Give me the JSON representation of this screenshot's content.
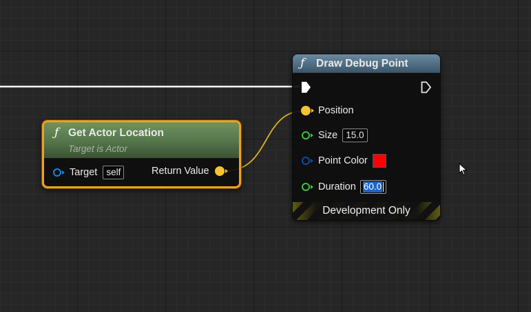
{
  "colors": {
    "graph_background": "#262626",
    "exec_wire": "#ffffff",
    "vector_wire": "#e2b225",
    "selection_outline": "#f0a020",
    "function_header_green": "#5b7a4e",
    "function_header_blue": "#4d6a80",
    "point_color_swatch": "#ff0000",
    "vector_pin": "#f6c22e",
    "object_pin": "#1786e6",
    "float_pin": "#3cc43c",
    "color_pin": "#134aa0"
  },
  "nodes": {
    "get_actor_location": {
      "title": "Get Actor Location",
      "subtitle": "Target is Actor",
      "icon": "function-icon",
      "selected": true,
      "inputs": [
        {
          "label": "Target",
          "value": "self",
          "pin_icon": "object-pin-icon"
        }
      ],
      "outputs": [
        {
          "label": "Return Value",
          "pin_icon": "vector-pin-icon"
        }
      ]
    },
    "draw_debug_point": {
      "title": "Draw Debug Point",
      "icon": "function-icon",
      "exec_in_icon": "exec-in-pin-icon",
      "exec_out_icon": "exec-out-pin-icon",
      "inputs": [
        {
          "label": "Position",
          "pin_icon": "vector-pin-icon"
        },
        {
          "label": "Size",
          "value": "15.0",
          "pin_icon": "float-pin-icon"
        },
        {
          "label": "Point Color",
          "value": "#ff0000",
          "pin_icon": "color-pin-icon"
        },
        {
          "label": "Duration",
          "value": "60.0",
          "pin_icon": "float-pin-icon",
          "editing": true
        }
      ],
      "footer": "Development Only"
    }
  },
  "cursor_icon": "mouse-pointer-icon"
}
